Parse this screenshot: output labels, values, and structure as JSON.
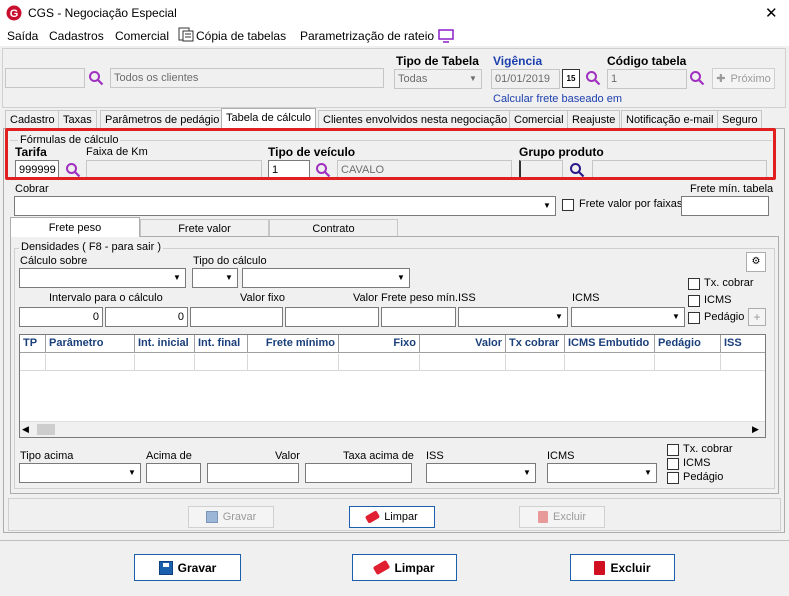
{
  "window": {
    "title": "CGS - Negociação Especial",
    "close_glyph": "✕"
  },
  "menu": {
    "saida": "Saída",
    "cadastros": "Cadastros",
    "comercial": "Comercial",
    "copia": "Cópia de tabelas",
    "rateio": "Parametrização de rateio"
  },
  "header": {
    "tipo_tabela_label": "Tipo de Tabela",
    "tipo_tabela_value": "Todas",
    "vigencia_label": "Vigência",
    "vigencia_value": "01/01/2019",
    "calendar_text": "15",
    "codigo_label": "Código tabela",
    "codigo_value": "1",
    "client_placeholder": "Todos os clientes",
    "proximo_label": "Próximo",
    "calcular_link": "Calcular frete baseado em"
  },
  "tabs": [
    "Cadastro",
    "Taxas",
    "Parâmetros de pedágio",
    "Tabela de cálculo",
    "Clientes envolvidos nesta negociação",
    "Comercial",
    "Reajuste",
    "Notificação e-mail",
    "Seguro"
  ],
  "formulas": {
    "group_label": "Fórmulas de cálculo",
    "tarifa_label": "Tarifa",
    "tarifa_value": "999999",
    "faixa_label": "Faixa de Km",
    "tipo_veiculo_label": "Tipo de veículo",
    "tipo_veiculo_code": "1",
    "tipo_veiculo_name": "CAVALO",
    "grupo_label": "Grupo produto"
  },
  "cobrar": {
    "label": "Cobrar",
    "frete_faixas": "Frete valor por faixas",
    "frete_min": "Frete mín. tabela"
  },
  "subtabs": [
    "Frete peso",
    "Frete valor",
    "Contrato"
  ],
  "densidades": {
    "group_label": "Densidades ( F8 - para sair )",
    "calculo_sobre": "Cálculo sobre",
    "tipo_calculo": "Tipo do cálculo",
    "intervalo": "Intervalo para o cálculo",
    "intervalo_from": "0",
    "intervalo_to": "0",
    "valor_fixo": "Valor fixo",
    "valor": "Valor",
    "frete_peso_min": "Frete peso mín.",
    "iss": "ISS",
    "icms": "ICMS",
    "tx_cobrar": "Tx. cobrar",
    "icms_chk": "ICMS",
    "pedagio_chk": "Pedágio",
    "columns": [
      "TP",
      "Parâmetro",
      "Int. inicial",
      "Int. final",
      "Frete mínimo",
      "Fixo",
      "Valor",
      "Tx cobrar",
      "ICMS Embutido",
      "Pedágio",
      "ISS"
    ]
  },
  "bottom": {
    "tipo_acima": "Tipo acima",
    "acima_de": "Acima de",
    "valor": "Valor",
    "taxa_acima": "Taxa acima de",
    "iss": "ISS",
    "icms": "ICMS",
    "tx_cobrar": "Tx. cobrar",
    "icms_chk": "ICMS",
    "pedagio_chk": "Pedágio"
  },
  "inner_buttons": {
    "gravar": "Gravar",
    "limpar": "Limpar",
    "excluir": "Excluir"
  },
  "footer_buttons": {
    "gravar": "Gravar",
    "limpar": "Limpar",
    "excluir": "Excluir"
  },
  "colors": {
    "highlight": "#e02020",
    "accent": "#1a3f7a",
    "link": "#1c3fae"
  }
}
